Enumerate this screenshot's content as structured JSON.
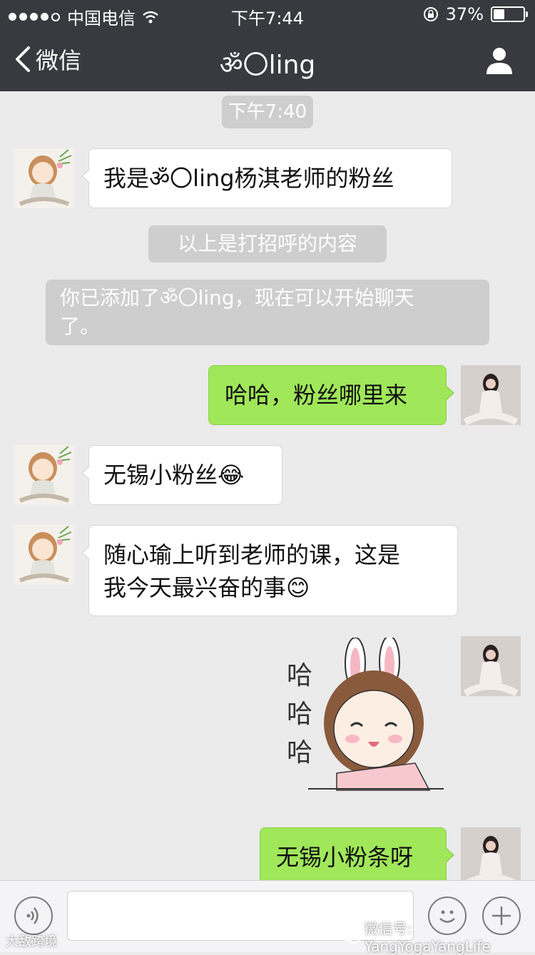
{
  "status_bar": {
    "carrier": "中国电信",
    "time": "下午7:44",
    "battery": "37%",
    "battery_level": 0.37
  },
  "nav": {
    "back_label": "微信",
    "title": "ॐ〇ling"
  },
  "chat": {
    "timestamp": "下午7:40",
    "msg1": "我是ॐ〇ling杨淇老师的粉丝",
    "greeting_note": "以上是打招呼的内容",
    "system_note_line1": "你已添加了ॐ〇ling，现在可以开始聊天",
    "system_note_line2": "了。",
    "msg2": "哈哈，粉丝哪里来",
    "msg3": "无锡小粉丝😂",
    "msg4_line1": "随心瑜上听到老师的课，这是",
    "msg4_line2": "我今天最兴奋的事😊",
    "sticker_text": [
      "哈",
      "哈",
      "哈"
    ],
    "msg5": "无锡小粉条呀"
  },
  "watermarks": {
    "bottom_right": "微信号: YangYogaYangLife",
    "bottom_left": "大敌跨境"
  },
  "colors": {
    "bar": "#393a3f",
    "background": "#ebebeb",
    "outgoing_bubble": "#a0e75a",
    "incoming_bubble": "#ffffff"
  }
}
